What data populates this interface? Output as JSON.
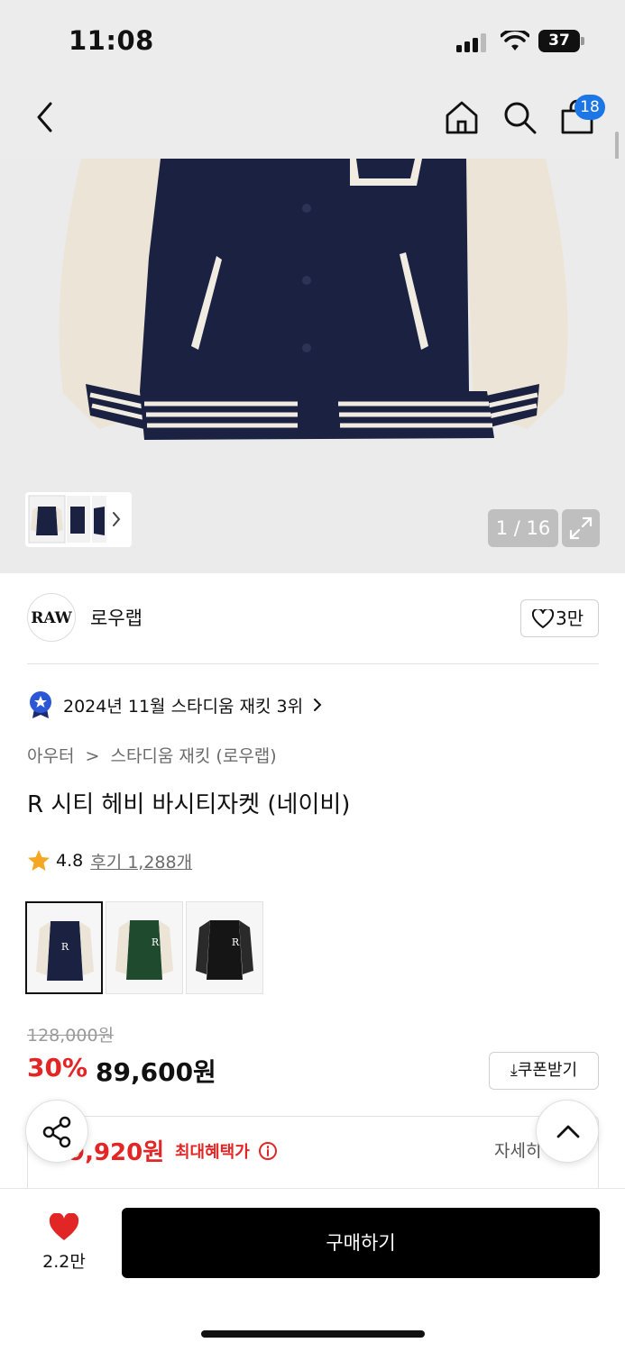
{
  "status_bar": {
    "time": "11:08",
    "battery": "37"
  },
  "header": {
    "cart_count": "18"
  },
  "hero": {
    "pager": "1 / 16"
  },
  "brand": {
    "logo_text": "RAW",
    "name": "로우랩",
    "likes": "3만"
  },
  "ranking": {
    "text": "2024년 11월 스타디움 재킷 3위"
  },
  "breadcrumb": {
    "category": "아우터",
    "separator": ">",
    "subcategory": "스타디움 재킷 (로우랩)"
  },
  "product": {
    "title": "R 시티 헤비 바시티자켓 (네이비)",
    "rating": "4.8",
    "reviews": "후기 1,288개",
    "colors": [
      "네이비",
      "그린",
      "블랙"
    ],
    "original_price": "128,000원",
    "discount": "30%",
    "price": "89,600원",
    "coupon_label": "쿠폰받기",
    "benefit_price": "9,920원",
    "benefit_label": "최대혜택가",
    "detail_label": "자세히"
  },
  "bottom": {
    "wish_count": "2.2만",
    "buy_label": "구매하기"
  },
  "colors": {
    "accent_red": "#e22626",
    "badge_blue": "#1d76e6",
    "navy": "#1b2140"
  }
}
